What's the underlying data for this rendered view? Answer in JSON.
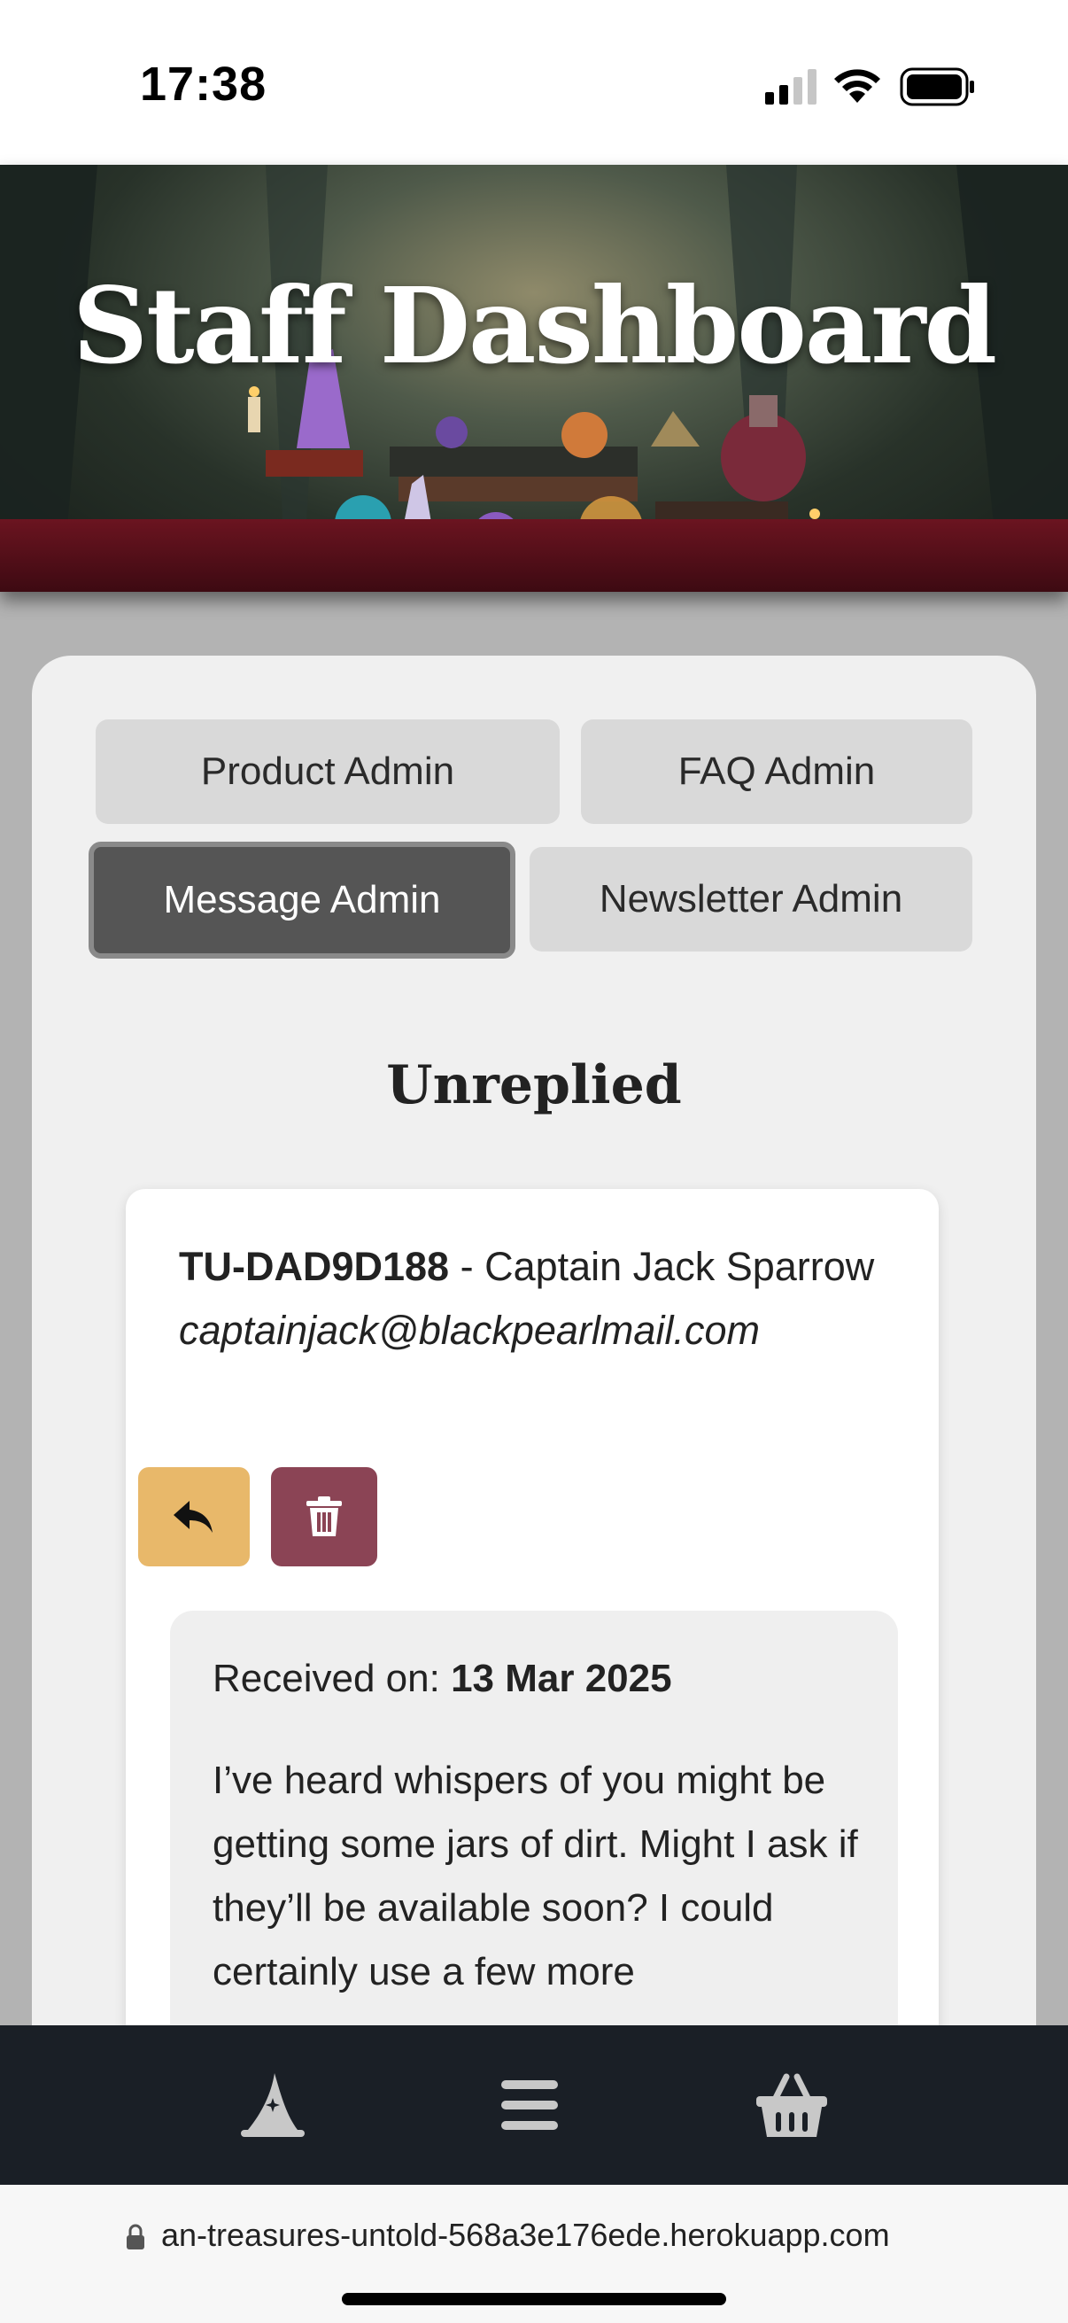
{
  "status_bar": {
    "time": "17:38"
  },
  "hero": {
    "title": "Staff Dashboard"
  },
  "admin_tabs": {
    "product": "Product Admin",
    "faq": "FAQ Admin",
    "message": "Message Admin",
    "newsletter": "Newsletter Admin",
    "active": "Message Admin"
  },
  "section": {
    "heading": "Unreplied"
  },
  "message": {
    "id": "TU-DAD9D188",
    "separator": " - ",
    "sender": "Captain Jack Sparrow",
    "email": "captainjack@blackpearlmail.com",
    "received_label": "Received on: ",
    "received_date": "13 Mar 2025",
    "text": "I’ve heard whispers of you might be getting some jars of dirt. Might I ask if they’ll be available soon? I could certainly use a few more"
  },
  "actions": {
    "reply_icon": "reply-icon",
    "delete_icon": "trash-icon"
  },
  "bottom_nav": [
    "wizard-hat-icon",
    "menu-icon",
    "basket-icon"
  ],
  "browser": {
    "url": "an-treasures-untold-568a3e176ede.herokuapp.com"
  },
  "colors": {
    "reply_button": "#e8b86a",
    "delete_button": "#8b4455",
    "active_tab": "#555555",
    "nav_background": "#1a1f26"
  }
}
